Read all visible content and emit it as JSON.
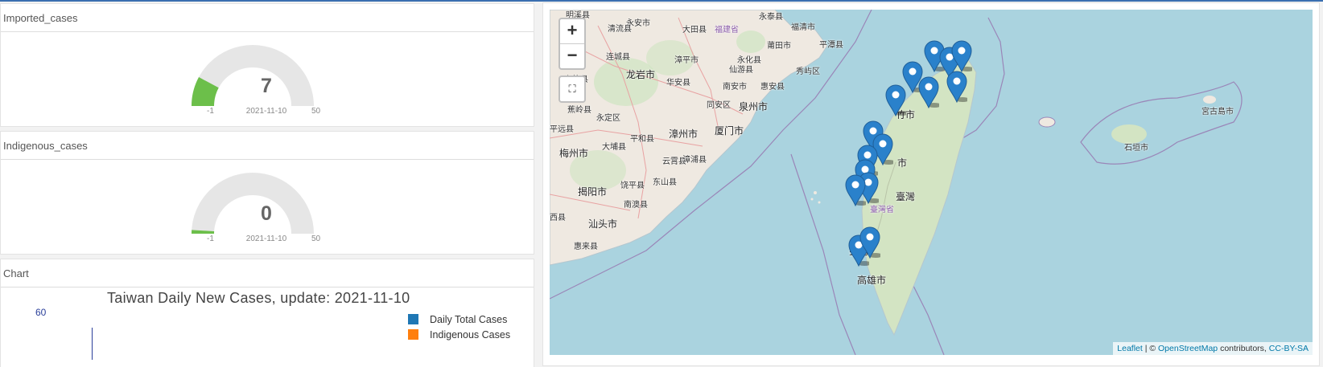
{
  "gauges": [
    {
      "title": "Imported_cases",
      "value": "7",
      "value_num": 7,
      "date": "2021-11-10",
      "min": "-1",
      "max": "50",
      "fill_color": "#6cbf4a"
    },
    {
      "title": "Indigenous_cases",
      "value": "0",
      "value_num": 0,
      "date": "2021-11-10",
      "min": "-1",
      "max": "50",
      "fill_color": "#6cbf4a"
    }
  ],
  "chart_panel": {
    "panel_title": "Chart",
    "title": "Taiwan Daily New Cases, update: 2021-11-10",
    "y_tick": "60",
    "legend": [
      {
        "label": "Daily Total Cases",
        "color": "#1f77b4"
      },
      {
        "label": "Indigenous Cases",
        "color": "#ff7f0e"
      }
    ]
  },
  "chart_data": {
    "type": "bar",
    "title": "Taiwan Daily New Cases, update: 2021-11-10",
    "xlabel": "",
    "ylabel": "",
    "y_ticks": [
      60
    ],
    "series": [
      {
        "name": "Daily Total Cases",
        "values": []
      },
      {
        "name": "Indigenous Cases",
        "values": []
      }
    ],
    "legend_position": "top-right"
  },
  "map": {
    "zoom_in": "+",
    "zoom_out": "−",
    "fullscreen_icon": "fullscreen-icon",
    "attribution": {
      "leaflet": "Leaflet",
      "sep1": " | © ",
      "osm": "OpenStreetMap",
      "contributors": " contributors, ",
      "license": "CC-BY-SA"
    },
    "labels": [
      {
        "id": "l1",
        "text": "福建省"
      },
      {
        "id": "l2",
        "text": "莆田市"
      },
      {
        "id": "l3",
        "text": "泉州市"
      },
      {
        "id": "l4",
        "text": "漳州市"
      },
      {
        "id": "l5",
        "text": "厦门市"
      },
      {
        "id": "l6",
        "text": "龙岩市"
      },
      {
        "id": "l7",
        "text": "梅州市"
      },
      {
        "id": "l8",
        "text": "揭阳市"
      },
      {
        "id": "l9",
        "text": "汕头市"
      },
      {
        "id": "l10",
        "text": "惠来县"
      },
      {
        "id": "l11",
        "text": "南澳县"
      },
      {
        "id": "l12",
        "text": "饶平县"
      },
      {
        "id": "l13",
        "text": "云霄县"
      },
      {
        "id": "l14",
        "text": "东山县"
      },
      {
        "id": "l15",
        "text": "漳浦县"
      },
      {
        "id": "l16",
        "text": "平和县"
      },
      {
        "id": "l17",
        "text": "大埔县"
      },
      {
        "id": "l18",
        "text": "永定区"
      },
      {
        "id": "l19",
        "text": "华安县"
      },
      {
        "id": "l20",
        "text": "漳平市"
      },
      {
        "id": "l21",
        "text": "同安区"
      },
      {
        "id": "l22",
        "text": "南安市"
      },
      {
        "id": "l23",
        "text": "惠安县"
      },
      {
        "id": "l24",
        "text": "秀屿区"
      },
      {
        "id": "l25",
        "text": "仙游县"
      },
      {
        "id": "l26",
        "text": "永化县"
      },
      {
        "id": "l27",
        "text": "大田县"
      },
      {
        "id": "l28",
        "text": "永安市"
      },
      {
        "id": "l29",
        "text": "清流县"
      },
      {
        "id": "l30",
        "text": "连城县"
      },
      {
        "id": "l31",
        "text": "上杭县"
      },
      {
        "id": "l32",
        "text": "蕉岭县"
      },
      {
        "id": "l33",
        "text": "平远县"
      },
      {
        "id": "l34",
        "text": "福清市"
      },
      {
        "id": "l35",
        "text": "永泰县"
      },
      {
        "id": "l36",
        "text": "平潭县"
      },
      {
        "id": "l37",
        "text": "臺灣"
      },
      {
        "id": "l38",
        "text": "臺灣省"
      },
      {
        "id": "l39",
        "text": "高雄市"
      },
      {
        "id": "l40",
        "text": "臺南"
      },
      {
        "id": "l41",
        "text": "竹市"
      },
      {
        "id": "l42",
        "text": "市"
      },
      {
        "id": "l43",
        "text": "宮古島市"
      },
      {
        "id": "l44",
        "text": "石垣市"
      },
      {
        "id": "l45",
        "text": "明溪县"
      },
      {
        "id": "l46",
        "text": "西县"
      },
      {
        "id": "l47",
        "text": "远县"
      }
    ],
    "marker_count": 15
  }
}
